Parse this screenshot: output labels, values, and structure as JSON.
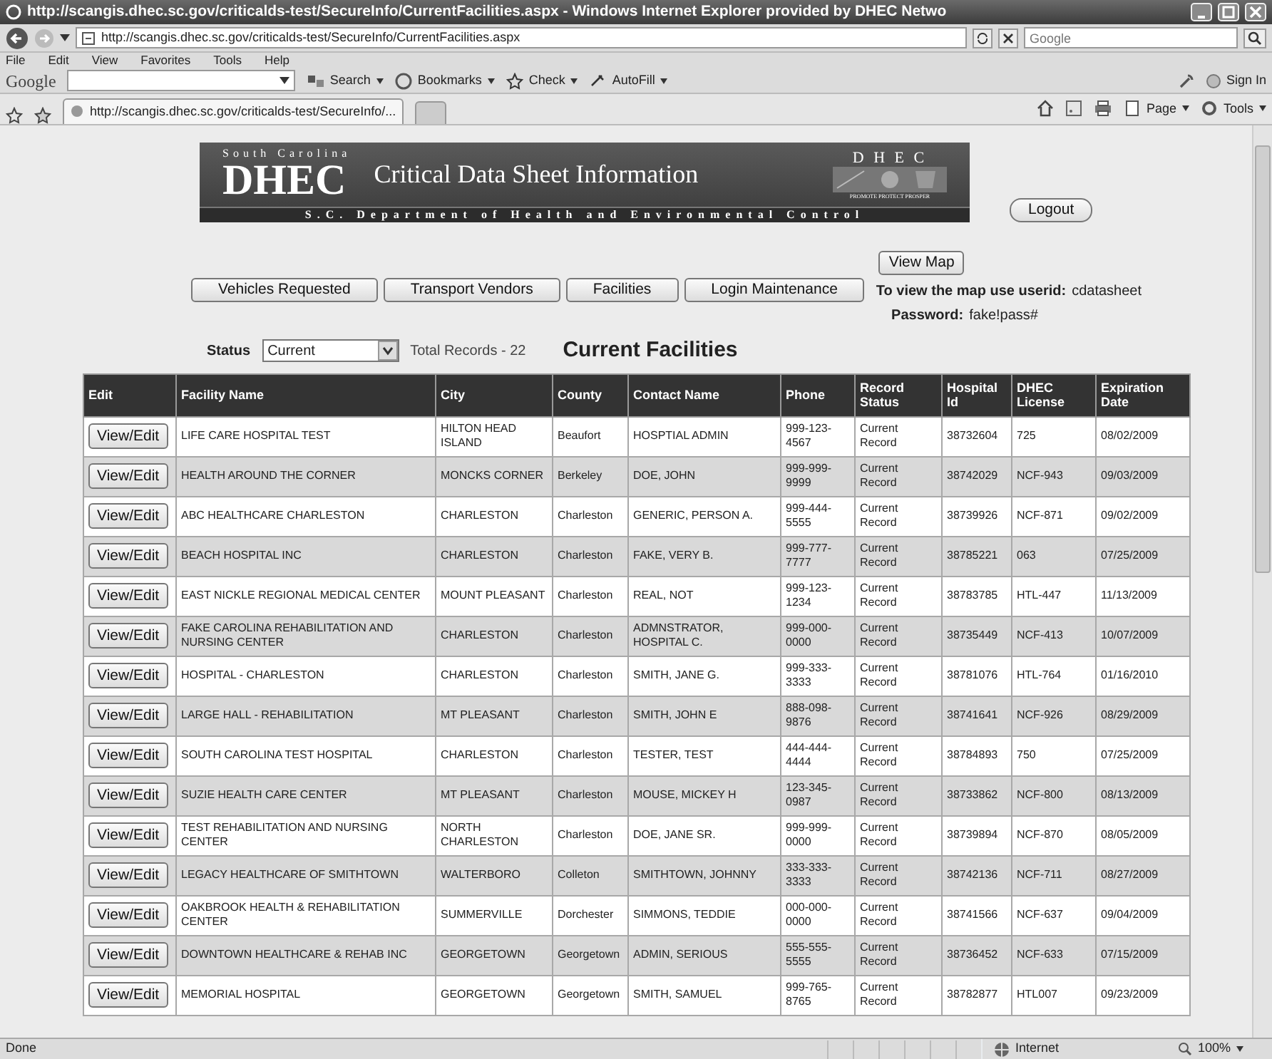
{
  "window": {
    "title": "http://scangis.dhec.sc.gov/criticalds-test/SecureInfo/CurrentFacilities.aspx - Windows Internet Explorer provided by DHEC Netwo"
  },
  "address_bar": {
    "url": "http://scangis.dhec.sc.gov/criticalds-test/SecureInfo/CurrentFacilities.aspx"
  },
  "search": {
    "placeholder": "Google"
  },
  "menu": [
    "File",
    "Edit",
    "View",
    "Favorites",
    "Tools",
    "Help"
  ],
  "google_toolbar": {
    "logo": "Google",
    "items": [
      "Search",
      "Bookmarks",
      "Check",
      "AutoFill"
    ],
    "sign_in": "Sign In"
  },
  "tabs": [
    {
      "label": "http://scangis.dhec.sc.gov/criticalds-test/SecureInfo/...",
      "selected": true
    }
  ],
  "command_bar": [
    "Page",
    "Tools"
  ],
  "banner": {
    "state": "South Carolina",
    "agency": "DHEC",
    "title": "Critical Data Sheet Information",
    "department": "S.C. Department of Health and Environmental Control",
    "logo_letters": "D H E C",
    "logo_tagline": "PROMOTE PROTECT PROSPER"
  },
  "logout": "Logout",
  "view_map": "View Map",
  "nav_buttons": [
    "Vehicles Requested",
    "Transport Vendors",
    "Facilities",
    "Login Maintenance"
  ],
  "map_hint": {
    "label": "To view the map use userid:",
    "userid": "cdatasheet",
    "password_label": "Password:",
    "password": "fake!pass#"
  },
  "filter": {
    "label": "Status",
    "value": "Current",
    "total": "Total Records - 22"
  },
  "heading": "Current Facilities",
  "table": {
    "columns": [
      "Edit",
      "Facility Name",
      "City",
      "County",
      "Contact Name",
      "Phone",
      "Record Status",
      "Hospital Id",
      "DHEC License",
      "Expiration Date"
    ],
    "rows": [
      {
        "cells": [
          "View/Edit",
          "LIFE CARE HOSPITAL TEST",
          "HILTON HEAD ISLAND",
          "Beaufort",
          "HOSPTIAL ADMIN",
          "999-123-4567",
          "Current Record",
          "38732604",
          "725",
          "08/02/2009"
        ]
      },
      {
        "cells": [
          "View/Edit",
          "HEALTH AROUND THE CORNER",
          "MONCKS CORNER",
          "Berkeley",
          "DOE, JOHN",
          "999-999-9999",
          "Current Record",
          "38742029",
          "NCF-943",
          "09/03/2009"
        ]
      },
      {
        "cells": [
          "View/Edit",
          "ABC HEALTHCARE CHARLESTON",
          "CHARLESTON",
          "Charleston",
          "GENERIC, PERSON A.",
          "999-444-5555",
          "Current Record",
          "38739926",
          "NCF-871",
          "09/02/2009"
        ]
      },
      {
        "cells": [
          "View/Edit",
          "BEACH HOSPITAL INC",
          "CHARLESTON",
          "Charleston",
          "FAKE, VERY B.",
          "999-777-7777",
          "Current Record",
          "38785221",
          "063",
          "07/25/2009"
        ]
      },
      {
        "cells": [
          "View/Edit",
          "EAST NICKLE REGIONAL MEDICAL CENTER",
          "MOUNT PLEASANT",
          "Charleston",
          "REAL, NOT",
          "999-123-1234",
          "Current Record",
          "38783785",
          "HTL-447",
          "11/13/2009"
        ]
      },
      {
        "cells": [
          "View/Edit",
          "FAKE CAROLINA REHABILITATION AND NURSING CENTER",
          "CHARLESTON",
          "Charleston",
          "ADMNSTRATOR, HOSPITAL C.",
          "999-000-0000",
          "Current Record",
          "38735449",
          "NCF-413",
          "10/07/2009"
        ]
      },
      {
        "cells": [
          "View/Edit",
          "HOSPITAL - CHARLESTON",
          "CHARLESTON",
          "Charleston",
          "SMITH, JANE G.",
          "999-333-3333",
          "Current Record",
          "38781076",
          "HTL-764",
          "01/16/2010"
        ]
      },
      {
        "cells": [
          "View/Edit",
          "LARGE HALL - REHABILITATION",
          "MT PLEASANT",
          "Charleston",
          "SMITH, JOHN E",
          "888-098-9876",
          "Current Record",
          "38741641",
          "NCF-926",
          "08/29/2009"
        ]
      },
      {
        "cells": [
          "View/Edit",
          "SOUTH CAROLINA TEST HOSPITAL",
          "CHARLESTON",
          "Charleston",
          "TESTER, TEST",
          "444-444-4444",
          "Current Record",
          "38784893",
          "750",
          "07/25/2009"
        ]
      },
      {
        "cells": [
          "View/Edit",
          "SUZIE HEALTH CARE CENTER",
          "MT PLEASANT",
          "Charleston",
          "MOUSE, MICKEY H",
          "123-345-0987",
          "Current Record",
          "38733862",
          "NCF-800",
          "08/13/2009"
        ]
      },
      {
        "cells": [
          "View/Edit",
          "TEST REHABILITATION AND NURSING CENTER",
          "NORTH CHARLESTON",
          "Charleston",
          "DOE, JANE SR.",
          "999-999-0000",
          "Current Record",
          "38739894",
          "NCF-870",
          "08/05/2009"
        ]
      },
      {
        "cells": [
          "View/Edit",
          "LEGACY HEALTHCARE OF SMITHTOWN",
          "WALTERBORO",
          "Colleton",
          "SMITHTOWN, JOHNNY",
          "333-333-3333",
          "Current Record",
          "38742136",
          "NCF-711",
          "08/27/2009"
        ]
      },
      {
        "cells": [
          "View/Edit",
          "OAKBROOK HEALTH & REHABILITATION CENTER",
          "SUMMERVILLE",
          "Dorchester",
          "SIMMONS, TEDDIE",
          "000-000-0000",
          "Current Record",
          "38741566",
          "NCF-637",
          "09/04/2009"
        ]
      },
      {
        "cells": [
          "View/Edit",
          "DOWNTOWN HEALTHCARE & REHAB INC",
          "GEORGETOWN",
          "Georgetown",
          "ADMIN, SERIOUS",
          "555-555-5555",
          "Current Record",
          "38736452",
          "NCF-633",
          "07/15/2009"
        ]
      },
      {
        "cells": [
          "View/Edit",
          "MEMORIAL HOSPITAL",
          "GEORGETOWN",
          "Georgetown",
          "SMITH, SAMUEL",
          "999-765-8765",
          "Current Record",
          "38782877",
          "HTL007",
          "09/23/2009"
        ]
      }
    ]
  },
  "status_bar": {
    "text": "Done",
    "zone": "Internet",
    "zoom": "100%"
  }
}
